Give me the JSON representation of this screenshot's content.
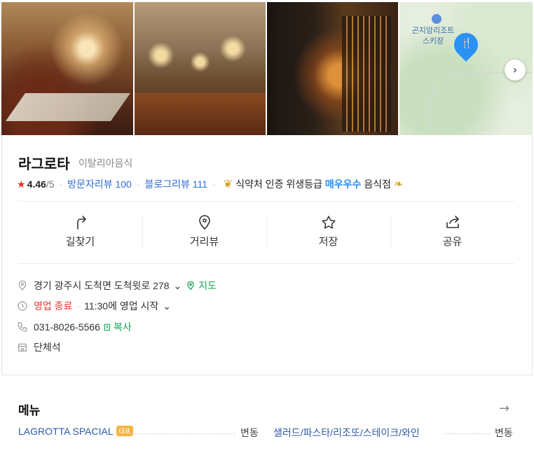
{
  "photos": {
    "map": {
      "poi_label": "곤지암리조트 스키장"
    }
  },
  "place": {
    "name": "라그로타",
    "category": "이탈리아음식",
    "rating": "4.46",
    "rating_max": "/5",
    "visitor_reviews": "방문자리뷰 100",
    "blog_reviews": "블로그리뷰 111",
    "cert_prefix": "식약처 인증 위생등급",
    "cert_grade": "매우우수",
    "cert_suffix": "음식점"
  },
  "actions": [
    {
      "label": "길찾기",
      "icon": "directions-icon"
    },
    {
      "label": "거리뷰",
      "icon": "location-pin-icon"
    },
    {
      "label": "저장",
      "icon": "star-outline-icon"
    },
    {
      "label": "공유",
      "icon": "share-icon"
    }
  ],
  "info": {
    "address": "경기 광주시 도척면 도척윗로 278",
    "map_link": "지도",
    "status": "영업 종료",
    "hours": "11:30에 영업 시작",
    "phone": "031-8026-5566",
    "copy": "복사",
    "facility": "단체석"
  },
  "menu": {
    "title": "메뉴",
    "items": [
      {
        "name": "LAGROTTA SPACIAL",
        "badge": "대표",
        "price": "변동"
      },
      {
        "name": "샐러드/파스타/리조또/스테이크/와인",
        "price": "변동"
      }
    ]
  },
  "colors": {
    "link": "#2e6dd1",
    "star": "#e8322b",
    "closed": "#e23c30",
    "green": "#1ca354",
    "cert_blue": "#2a8ef0",
    "badge": "#f5b440",
    "map_pin": "#2a91f5"
  }
}
